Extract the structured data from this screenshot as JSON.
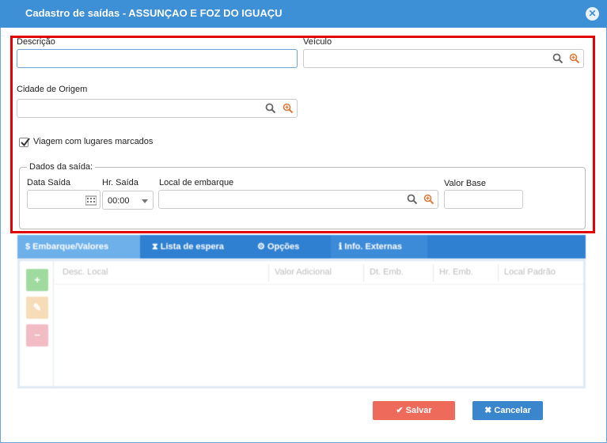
{
  "window": {
    "title": "Cadastro de saídas - ASSUNÇAO E FOZ DO IGUAÇU",
    "close_icon": "close-icon"
  },
  "form": {
    "descricao_label": "Descrição",
    "descricao_value": "",
    "veiculo_label": "Veículo",
    "veiculo_value": "",
    "cidade_label": "Cidade de Origem",
    "cidade_value": "",
    "viagem_label": "Viagem com lugares marcados",
    "viagem_checked": true,
    "fieldset_legend": "Dados da saída:",
    "data_saida_label": "Data Saída",
    "data_saida_value": "",
    "hr_saida_label": "Hr. Saída",
    "hr_saida_value": "00:00",
    "local_embarque_label": "Local de embarque",
    "local_embarque_value": "",
    "valor_base_label": "Valor Base",
    "valor_base_value": ""
  },
  "tabs": [
    {
      "label": "$ Embarque/Valores",
      "active": true
    },
    {
      "label": "⧗ Lista de espera",
      "active": false
    },
    {
      "label": "⚙ Opções",
      "active": false
    },
    {
      "label": "ℹ Info. Externas",
      "active": false
    }
  ],
  "grid": {
    "columns": [
      "Desc. Local",
      "Valor Adicional",
      "Dt. Emb.",
      "Hr. Emb.",
      "Local Padrão"
    ],
    "side_buttons": [
      "+",
      "✎",
      "−"
    ]
  },
  "buttons": {
    "save": "Salvar",
    "cancel": "Cancelar"
  },
  "colors": {
    "titlebar": "#3d8fd6",
    "save": "#ee6a5a",
    "cancel": "#3a86cc",
    "highlight": "#e00000"
  }
}
